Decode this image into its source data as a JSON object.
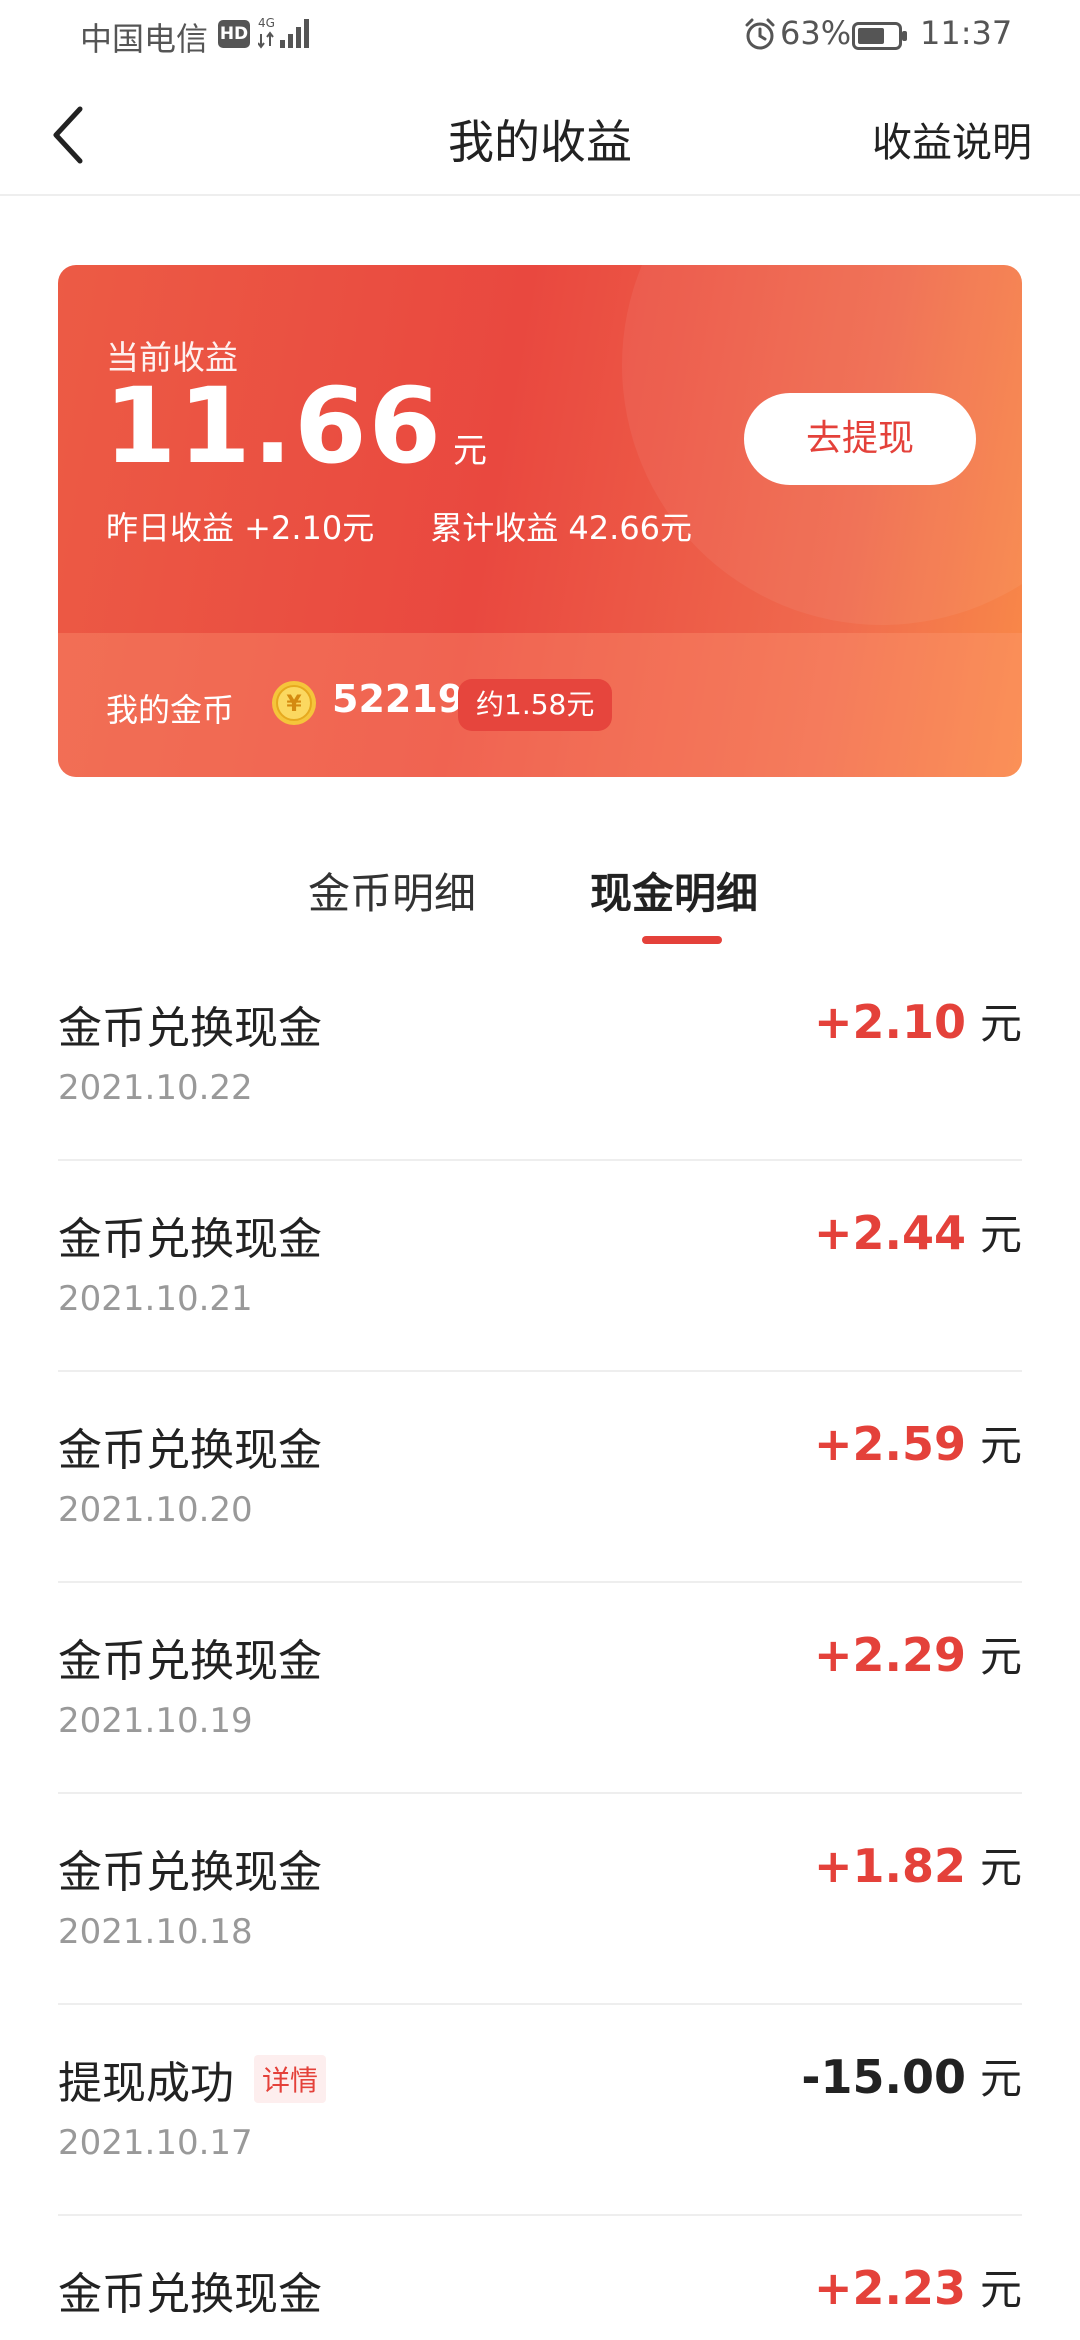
{
  "status_bar": {
    "carrier": "中国电信",
    "hd": "HD",
    "network": "4G",
    "battery_percent": "63%",
    "time": "11:37"
  },
  "nav": {
    "title": "我的收益",
    "right_link": "收益说明",
    "back_icon": "chevron-left-icon"
  },
  "earnings": {
    "label": "当前收益",
    "amount": "11.66",
    "unit": "元",
    "withdraw_label": "去提现",
    "yesterday": "昨日收益 +2.10元",
    "total": "累计收益 42.66元",
    "coin_label": "我的金币",
    "coin_count": "52219",
    "coin_approx": "约1.58元",
    "coin_symbol": "¥"
  },
  "tabs": [
    {
      "label": "金币明细",
      "active": false
    },
    {
      "label": "现金明细",
      "active": true
    }
  ],
  "records": [
    {
      "title": "金币兑换现金",
      "date": "2021.10.22",
      "amount": "+2.10",
      "unit": "元",
      "detail": ""
    },
    {
      "title": "金币兑换现金",
      "date": "2021.10.21",
      "amount": "+2.44",
      "unit": "元",
      "detail": ""
    },
    {
      "title": "金币兑换现金",
      "date": "2021.10.20",
      "amount": "+2.59",
      "unit": "元",
      "detail": ""
    },
    {
      "title": "金币兑换现金",
      "date": "2021.10.19",
      "amount": "+2.29",
      "unit": "元",
      "detail": ""
    },
    {
      "title": "金币兑换现金",
      "date": "2021.10.18",
      "amount": "+1.82",
      "unit": "元",
      "detail": ""
    },
    {
      "title": "提现成功",
      "date": "2021.10.17",
      "amount": "-15.00",
      "unit": "元",
      "detail": "详情"
    },
    {
      "title": "金币兑换现金",
      "date": "",
      "amount": "+2.23",
      "unit": "元",
      "detail": ""
    }
  ],
  "colors": {
    "accent": "#e4413a",
    "card_start": "#ec5b45",
    "card_end": "#f98a48"
  }
}
